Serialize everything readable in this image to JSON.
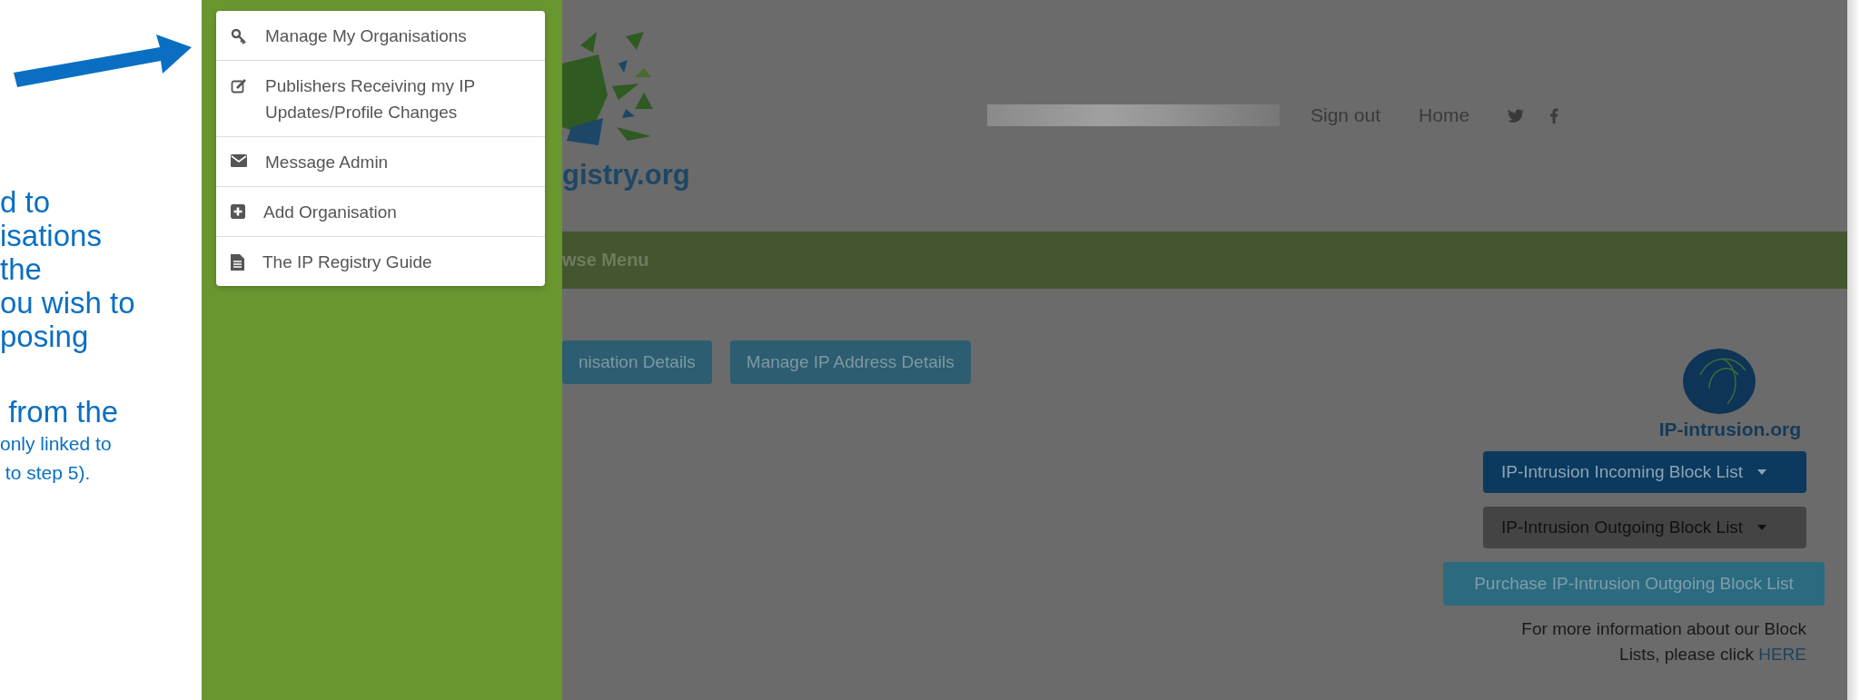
{
  "annotation": {
    "lines": [
      "d to",
      "isations",
      "the",
      "ou wish to",
      "posing",
      " from the"
    ],
    "notes": [
      "only linked to",
      " to step 5)."
    ]
  },
  "sidebar_menu": [
    {
      "label": "Manage My Organisations"
    },
    {
      "label": "Publishers Receiving my IP Updates/Profile Changes"
    },
    {
      "label": "Message Admin"
    },
    {
      "label": "Add Organisation"
    },
    {
      "label": "The IP Registry Guide"
    }
  ],
  "header": {
    "logo_text": "gistry.org",
    "links": [
      "Sign out",
      "Home"
    ]
  },
  "nav_bar": {
    "label": "wse Menu"
  },
  "buttons": [
    "nisation Details",
    "Manage IP Address Details"
  ],
  "partner": {
    "name": "IP-intrusion.org",
    "dropdowns": [
      {
        "label": "IP-Intrusion Incoming Block List",
        "kind": "primary"
      },
      {
        "label": "IP-Intrusion Outgoing Block List",
        "kind": "dark"
      }
    ],
    "purchase_button": "Purchase IP-Intrusion Outgoing Block List",
    "info": "For more information about our Block Lists, please click",
    "link": "HERE"
  }
}
